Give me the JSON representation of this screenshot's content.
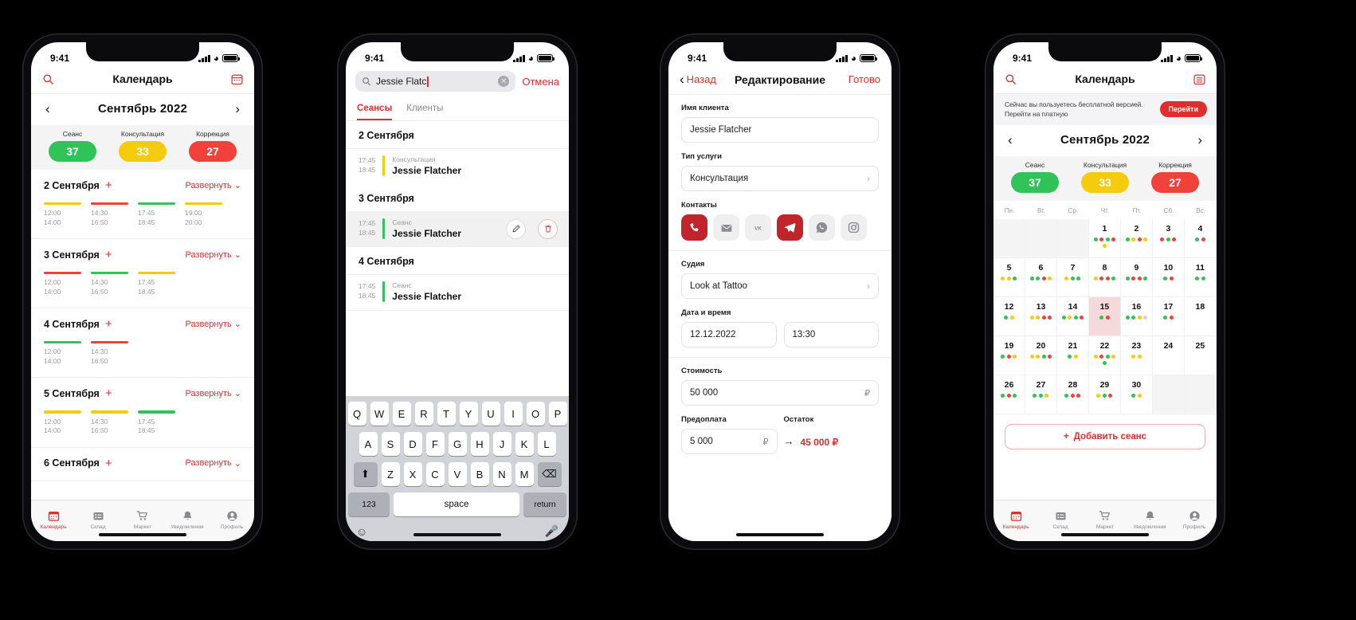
{
  "statusbar": {
    "time": "9:41"
  },
  "colors": {
    "accent": "#e02d2d",
    "green": "#2fc35a",
    "yellow": "#f5cb0d",
    "red": "#f0413b"
  },
  "phone1": {
    "nav": {
      "title": "Календарь",
      "search_icon": "search-icon",
      "calendar_icon": "calendar-icon"
    },
    "month": {
      "label": "Сентябрь 2022",
      "prev": "‹",
      "next": "›"
    },
    "legend": [
      {
        "name": "Сеанс",
        "count": "37",
        "color": "#2fc35a"
      },
      {
        "name": "Консультация",
        "count": "33",
        "color": "#f5cb0d"
      },
      {
        "name": "Коррекция",
        "count": "27",
        "color": "#f0413b"
      }
    ],
    "expand_label": "Развернуть",
    "days": [
      {
        "title": "2 Сентября",
        "slots": [
          {
            "color": "#f5cb0d",
            "from": "12:00",
            "to": "14:00"
          },
          {
            "color": "#f0413b",
            "from": "14:30",
            "to": "16:50"
          },
          {
            "color": "#2fc35a",
            "from": "17:45",
            "to": "18:45"
          },
          {
            "color": "#f5cb0d",
            "from": "19:00",
            "to": "20:00"
          }
        ]
      },
      {
        "title": "3 Сентября",
        "slots": [
          {
            "color": "#f0413b",
            "from": "12:00",
            "to": "14:00"
          },
          {
            "color": "#2fc35a",
            "from": "14:30",
            "to": "16:50"
          },
          {
            "color": "#f5cb0d",
            "from": "17:45",
            "to": "18:45"
          }
        ]
      },
      {
        "title": "4 Сентября",
        "slots": [
          {
            "color": "#2fc35a",
            "from": "12:00",
            "to": "14:00"
          },
          {
            "color": "#f0413b",
            "from": "14:30",
            "to": "16:50"
          }
        ]
      },
      {
        "title": "5 Сентября",
        "slots": [
          {
            "color": "#f5cb0d",
            "from": "12:00",
            "to": "14:00"
          },
          {
            "color": "#f5cb0d",
            "from": "14:30",
            "to": "16:50"
          },
          {
            "color": "#2fc35a",
            "from": "17:45",
            "to": "18:45"
          }
        ]
      },
      {
        "title": "6 Сентября",
        "slots": []
      }
    ]
  },
  "phone2": {
    "search": {
      "value": "Jessie Flatc",
      "placeholder": "Поиск",
      "cancel": "Отмена"
    },
    "tabs": [
      {
        "label": "Сеансы",
        "active": true
      },
      {
        "label": "Клиенты",
        "active": false
      }
    ],
    "groups": [
      {
        "date": "2 Сентября",
        "rows": [
          {
            "from": "17:45",
            "to": "18:45",
            "type": "Консультация",
            "name": "Jessie Flatcher",
            "color": "#f5cb0d",
            "selected": false
          }
        ]
      },
      {
        "date": "3 Сентября",
        "rows": [
          {
            "from": "17:45",
            "to": "18:45",
            "type": "Сеанс",
            "name": "Jessie Flatcher",
            "color": "#2fc35a",
            "selected": true
          }
        ]
      },
      {
        "date": "4 Сентября",
        "rows": [
          {
            "from": "17:45",
            "to": "18:45",
            "type": "Сеанс",
            "name": "Jessie Flatcher",
            "color": "#2fc35a",
            "selected": false
          }
        ]
      }
    ],
    "keyboard": {
      "row1": [
        "Q",
        "W",
        "E",
        "R",
        "T",
        "Y",
        "U",
        "I",
        "O",
        "P"
      ],
      "row2": [
        "A",
        "S",
        "D",
        "F",
        "G",
        "H",
        "J",
        "K",
        "L"
      ],
      "row3": [
        "Z",
        "X",
        "C",
        "V",
        "B",
        "N",
        "M"
      ],
      "num": "123",
      "space": "space",
      "return": "return"
    }
  },
  "phone3": {
    "nav": {
      "back": "Назад",
      "title": "Редактирование",
      "done": "Готово"
    },
    "fields": {
      "client_label": "Имя клиента",
      "client_value": "Jessie Flatcher",
      "service_label": "Тип услуги",
      "service_value": "Консультация",
      "contacts_label": "Контакты",
      "master_label": "Судия",
      "master_value": "Look at Tattoo",
      "datetime_label": "Дата и время",
      "date_value": "12.12.2022",
      "time_value": "13:30",
      "price_label": "Стоимость",
      "price_value": "50 000",
      "prepay_label": "Предоплата",
      "prepay_value": "5 000",
      "rest_label": "Остаток",
      "rest_value": "45 000 ₽",
      "currency": "₽"
    },
    "contacts": [
      {
        "icon": "phone-icon",
        "active": true
      },
      {
        "icon": "email-icon",
        "active": false
      },
      {
        "icon": "vk-icon",
        "active": false
      },
      {
        "icon": "telegram-icon",
        "active": true
      },
      {
        "icon": "whatsapp-icon",
        "active": false
      },
      {
        "icon": "instagram-icon",
        "active": false
      }
    ]
  },
  "phone4": {
    "nav": {
      "title": "Календарь",
      "search_icon": "search-icon",
      "list-icon": "list-view-icon"
    },
    "banner": {
      "text": "Сейчас вы пользуетесь бесплатной версией. Перейти на платную",
      "button": "Перейти"
    },
    "month": {
      "label": "Сентябрь 2022",
      "prev": "‹",
      "next": "›"
    },
    "legend": [
      {
        "name": "Сеанс",
        "count": "37",
        "color": "#2fc35a"
      },
      {
        "name": "Консультация",
        "count": "33",
        "color": "#f5cb0d"
      },
      {
        "name": "Коррекция",
        "count": "27",
        "color": "#f0413b"
      }
    ],
    "weekdays": [
      "Пн.",
      "Вт.",
      "Ср.",
      "Чт.",
      "Пт.",
      "Сб.",
      "Вс."
    ],
    "cells": [
      {
        "blank": true
      },
      {
        "blank": true
      },
      {
        "blank": true
      },
      {
        "day": "1",
        "dots": [
          "g",
          "r",
          "g",
          "r",
          "y"
        ]
      },
      {
        "day": "2",
        "dots": [
          "g",
          "y",
          "r",
          "y"
        ]
      },
      {
        "day": "3",
        "dots": [
          "r",
          "g",
          "r"
        ]
      },
      {
        "day": "4",
        "dots": [
          "g",
          "r"
        ]
      },
      {
        "day": "5",
        "dots": [
          "y",
          "y",
          "g"
        ]
      },
      {
        "day": "6",
        "dots": [
          "g",
          "g",
          "r",
          "y"
        ]
      },
      {
        "day": "7",
        "dots": [
          "y",
          "g",
          "g"
        ]
      },
      {
        "day": "8",
        "dots": [
          "y",
          "r",
          "r",
          "g"
        ]
      },
      {
        "day": "9",
        "dots": [
          "g",
          "r",
          "r",
          "g"
        ]
      },
      {
        "day": "10",
        "dots": [
          "g",
          "r"
        ]
      },
      {
        "day": "11",
        "dots": [
          "g",
          "g"
        ]
      },
      {
        "day": "12",
        "dots": [
          "g",
          "y"
        ]
      },
      {
        "day": "13",
        "dots": [
          "y",
          "y",
          "r",
          "r"
        ]
      },
      {
        "day": "14",
        "dots": [
          "g",
          "y",
          "g",
          "r"
        ]
      },
      {
        "day": "15",
        "dots": [
          "g",
          "r"
        ],
        "selected": true
      },
      {
        "day": "16",
        "dots": [
          "g",
          "g",
          "y",
          "x"
        ]
      },
      {
        "day": "17",
        "dots": [
          "g",
          "r"
        ]
      },
      {
        "day": "18",
        "dots": []
      },
      {
        "day": "19",
        "dots": [
          "g",
          "r",
          "y"
        ]
      },
      {
        "day": "20",
        "dots": [
          "y",
          "y",
          "g",
          "r"
        ]
      },
      {
        "day": "21",
        "dots": [
          "g",
          "y"
        ]
      },
      {
        "day": "22",
        "dots": [
          "y",
          "r",
          "g",
          "y",
          "g"
        ]
      },
      {
        "day": "23",
        "dots": [
          "y",
          "y"
        ]
      },
      {
        "day": "24",
        "dots": []
      },
      {
        "day": "25",
        "dots": []
      },
      {
        "day": "26",
        "dots": [
          "g",
          "r",
          "g"
        ]
      },
      {
        "day": "27",
        "dots": [
          "g",
          "g",
          "y"
        ]
      },
      {
        "day": "28",
        "dots": [
          "g",
          "r",
          "r"
        ]
      },
      {
        "day": "29",
        "dots": [
          "y",
          "g",
          "r"
        ]
      },
      {
        "day": "30",
        "dots": [
          "g",
          "y"
        ]
      },
      {
        "blank": true
      },
      {
        "blank": true
      }
    ],
    "add_button": "Добавить сеанс",
    "add_plus": "+"
  },
  "tabbar": [
    {
      "label": "Календарь",
      "icon": "calendar-icon",
      "active": true
    },
    {
      "label": "Склад",
      "icon": "list-icon",
      "active": false
    },
    {
      "label": "Маркет",
      "icon": "cart-icon",
      "active": false
    },
    {
      "label": "Уведомления",
      "icon": "bell-icon",
      "active": false
    },
    {
      "label": "Профиль",
      "icon": "profile-icon",
      "active": false
    }
  ]
}
